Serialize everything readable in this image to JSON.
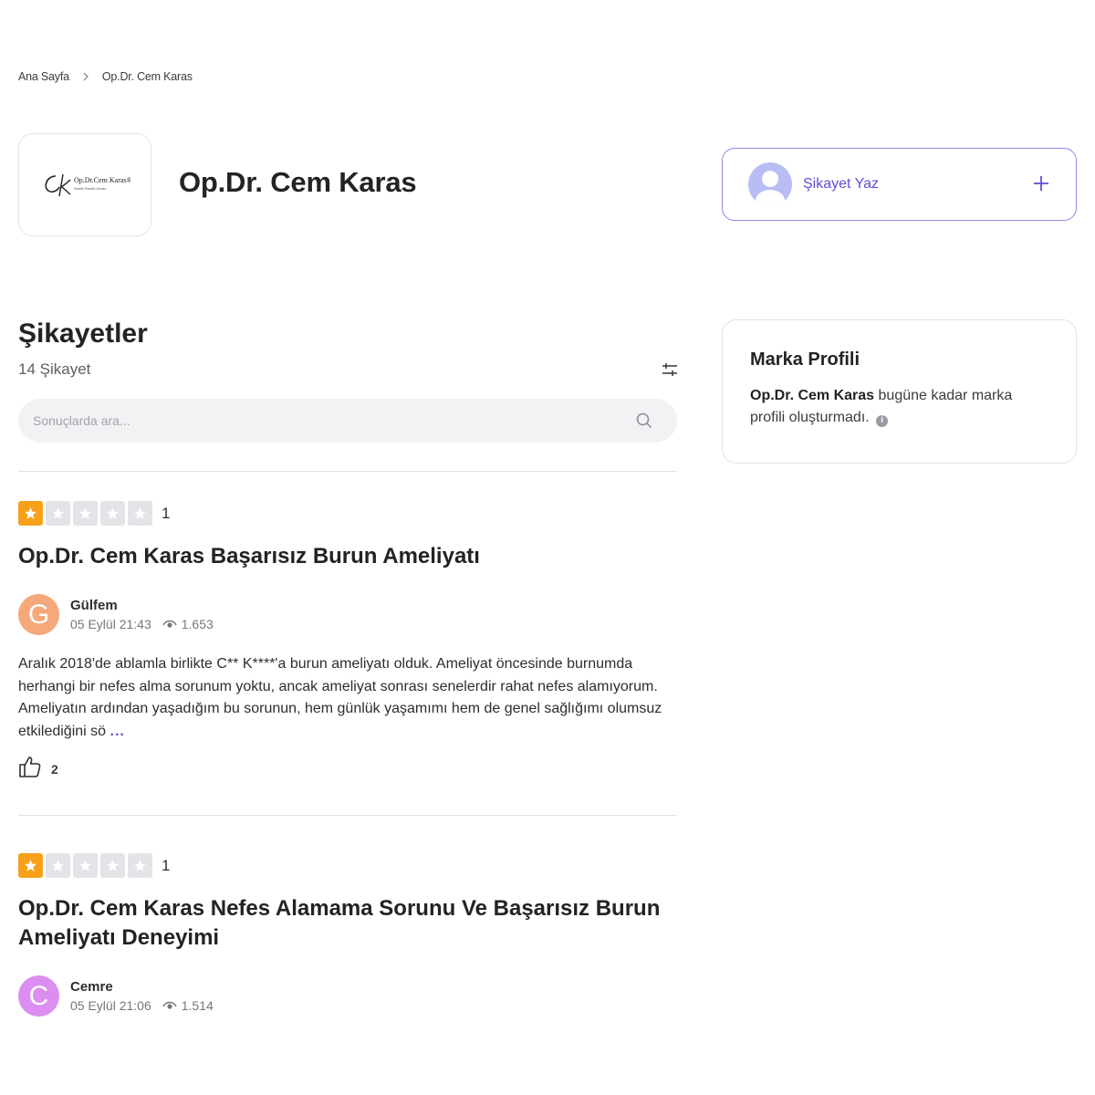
{
  "breadcrumb": {
    "home": "Ana Sayfa",
    "current": "Op.Dr. Cem Karas"
  },
  "brand": {
    "name": "Op.Dr. Cem Karas",
    "logo_text": "Op.Dr.Cem Karas®",
    "logo_sub": "Estetik Plastik Cerrahi"
  },
  "write": {
    "label": "Şikayet Yaz"
  },
  "complaints": {
    "title": "Şikayetler",
    "count": "14 Şikayet",
    "search_placeholder": "Sonuçlarda ara..."
  },
  "profile": {
    "title": "Marka Profili",
    "brand": "Op.Dr. Cem Karas",
    "text": "bugüne kadar marka profili oluşturmadı."
  },
  "items": [
    {
      "rating": "1",
      "stars": 1,
      "title": "Op.Dr. Cem Karas Başarısız Burun Ameliyatı",
      "initial": "G",
      "avatar_color": "#f5a97a",
      "author": "Gülfem",
      "date": "05 Eylül 21:43",
      "views": "1.653",
      "body": "Aralık 2018'de ablamla birlikte C** K****'a burun ameliyatı olduk. Ameliyat öncesinde burnumda herhangi bir nefes alma sorunum yoktu, ancak ameliyat sonrası senelerdir rahat nefes alamıyorum. Ameliyatın ardından yaşadığım bu sorunun, hem günlük yaşamımı hem de genel sağlığımı olumsuz etkilediğini sö",
      "more": "...",
      "likes": "2"
    },
    {
      "rating": "1",
      "stars": 1,
      "title": "Op.Dr. Cem Karas Nefes Alamama Sorunu Ve Başarısız Burun Ameliyatı Deneyimi",
      "initial": "C",
      "avatar_color": "#dc8ef0",
      "author": "Cemre",
      "date": "05 Eylül 21:06",
      "views": "1.514"
    }
  ]
}
